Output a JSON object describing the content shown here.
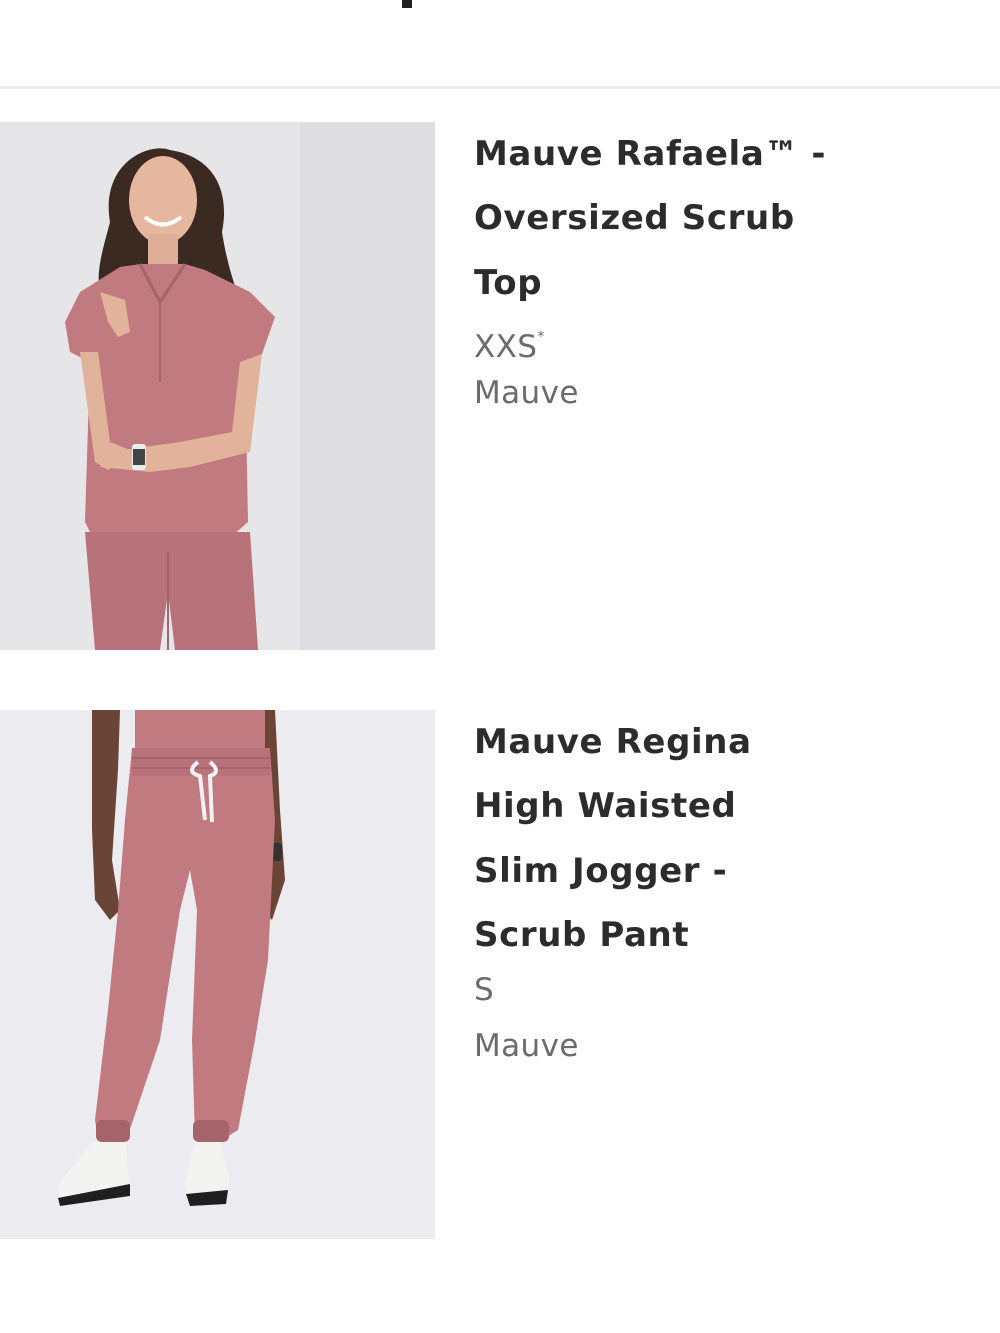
{
  "products": [
    {
      "title_lines": [
        "Mauve Rafaela™ -",
        "Oversized Scrub",
        "Top"
      ],
      "size": "XXS",
      "size_marker": "*",
      "color": "Mauve",
      "image": "woman-wearing-mauve-scrub-top-photo"
    },
    {
      "title_lines": [
        "Mauve Regina",
        "High Waisted",
        "Slim Jogger -",
        "Scrub Pant"
      ],
      "size": "S",
      "color": "Mauve",
      "image": "person-wearing-mauve-jogger-pants-photo"
    }
  ],
  "colors": {
    "mauve": "#c07a80",
    "mauve_dark": "#a5636a",
    "title_text": "#2c2c2c",
    "meta_text": "#6b6b6b",
    "divider": "#ebebeb",
    "photo_bg_top": "#e6e5e8",
    "photo_bg_pant": "#ecebf0"
  }
}
